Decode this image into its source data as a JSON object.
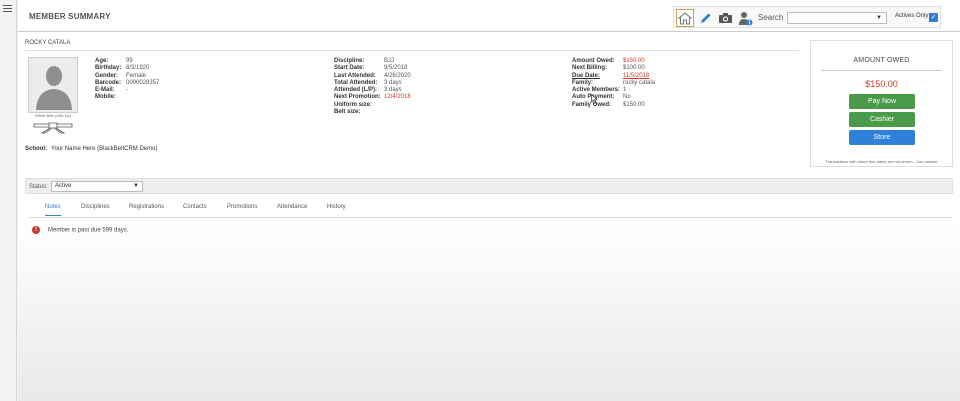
{
  "page": {
    "title": "MEMBER SUMMARY"
  },
  "toolbar": {
    "icons": [
      "home-icon",
      "pencil-icon",
      "camera-icon",
      "member-info-icon"
    ],
    "search_label": "Search",
    "search_value": "",
    "actives_only_label": "Actives Only:",
    "actives_only_checked": true
  },
  "member": {
    "name": "ROCKY CATALA",
    "belt_label": "White Belt (10th Ky)",
    "col1": [
      {
        "label": "Age:",
        "value": "99"
      },
      {
        "label": "Birthday:",
        "value": "8/3/1920"
      },
      {
        "label": "Gender:",
        "value": "Female"
      },
      {
        "label": "Barcode:",
        "value": "0000028357"
      },
      {
        "label": "E-Mail:",
        "value": "-"
      },
      {
        "label": "Mobile:",
        "value": ""
      }
    ],
    "col2": [
      {
        "label": "Discipline:",
        "value": "BJJ"
      },
      {
        "label": "Start Date:",
        "value": "9/5/2018"
      },
      {
        "label": "Last Attended:",
        "value": "4/26/2020"
      },
      {
        "label": "Total Attended:",
        "value": "3 days"
      },
      {
        "label": "Attended (L/P):",
        "value": "3 days"
      },
      {
        "label": "Next Promotion:",
        "value": "12/4/2018"
      },
      {
        "label": "Uniform size:",
        "value": ""
      },
      {
        "label": "Belt size:",
        "value": ""
      }
    ],
    "col3": [
      {
        "label": "Amount Owed:",
        "value": "$150.00"
      },
      {
        "label": "Next Billing:",
        "value": "$100.00"
      },
      {
        "label": "Due Date:",
        "value": "11/5/2018"
      },
      {
        "label": "Family:",
        "value": "rocky catala"
      },
      {
        "label": "Active Members:",
        "value": "1"
      },
      {
        "label": "Auto Payment:",
        "value": "No"
      },
      {
        "label": "Family Owed:",
        "value": "$150.00"
      }
    ],
    "school_label": "School:",
    "school_value": "Your Name Here (BlackBeltCRM Demo)"
  },
  "owed_panel": {
    "title": "AMOUNT OWED",
    "amount": "$150.00",
    "pay_now": "Pay Now",
    "cashier": "Cashier",
    "store": "Store",
    "note": "Transactions with future due dates are not shown - Use cashier"
  },
  "status": {
    "label": "Status:",
    "value": "Active"
  },
  "tabs": [
    "Notes",
    "Disciplines",
    "Registrations",
    "Contacts",
    "Promotions",
    "Attendance",
    "History"
  ],
  "alert": {
    "text": "Member is past due 599 days."
  },
  "colors": {
    "accent": "#2f7fd4",
    "danger": "#d0392b",
    "success": "#4a9a4a"
  }
}
